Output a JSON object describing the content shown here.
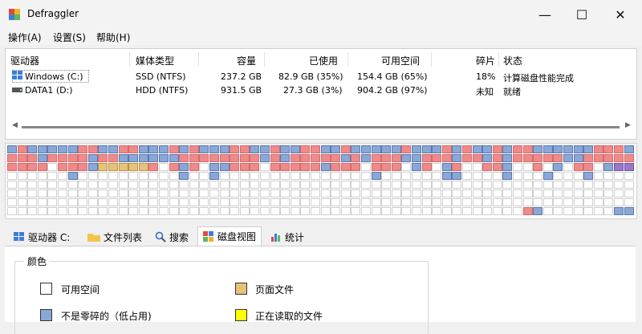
{
  "window": {
    "title": "Defraggler"
  },
  "window_controls": {
    "minimize": "—",
    "maximize": "☐",
    "close": "✕"
  },
  "menu": [
    "操作(A)",
    "设置(S)",
    "帮助(H)"
  ],
  "drives": {
    "headers": [
      "驱动器",
      "媒体类型",
      "容量",
      "已使用",
      "可用空间",
      "碎片",
      "状态"
    ],
    "rows": [
      [
        "Windows (C:)",
        "SSD (NTFS)",
        "237.2 GB",
        "82.9 GB (35%)",
        "154.4 GB (65%)",
        "18%",
        "计算磁盘性能完成"
      ],
      [
        "DATA1 (D:)",
        "HDD (NTFS)",
        "931.5 GB",
        "27.3 GB (3%)",
        "904.2 GB (97%)",
        "未知",
        "就绪"
      ]
    ]
  },
  "tabs": [
    "驱动器 C:",
    "文件列表",
    "搜索",
    "磁盘视图",
    "统计"
  ],
  "active_tab": 3,
  "legend": {
    "title": "颜色",
    "items": [
      {
        "label": "可用空间",
        "color": "#ffffff"
      },
      {
        "label": "页面文件",
        "color": "#e6c27a"
      },
      {
        "label": "不是零碎的（低占用)",
        "color": "#8aa7d6"
      },
      {
        "label": "正在读取的文件",
        "color": "#ffff00"
      }
    ]
  },
  "colors": {
    "fragmented": "#ef8a8a",
    "not_fragmented": "#8aa7d6",
    "free": "#ffffff",
    "pagefile": "#e6c27a",
    "mft": "#9b79c8"
  }
}
